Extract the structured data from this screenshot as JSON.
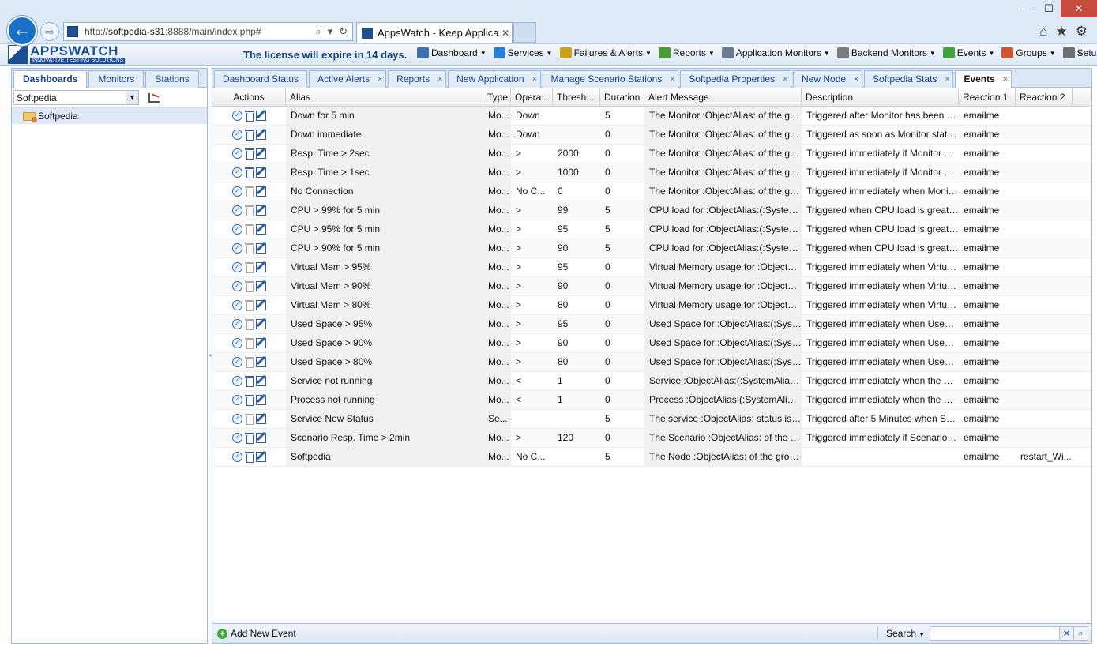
{
  "browser": {
    "url_prefix": "http://",
    "url_domain": "softpedia-s31",
    "url_rest": ":8888/main/index.php#",
    "tab_title": "AppsWatch - Keep Applicat...",
    "tab_close": "✕",
    "back_glyph": "←",
    "forward_glyph": "⇨",
    "search_glyph": "⌕",
    "dropdown_glyph": "▾",
    "refresh_glyph": "↻",
    "home_glyph": "⌂",
    "favorite_glyph": "★",
    "settings_glyph": "⚙",
    "minimize_glyph": "—",
    "maximize_glyph": "☐",
    "close_glyph": "✕"
  },
  "app": {
    "logo_name": "APPSWATCH",
    "logo_tagline": "INNOVATIVE TESTING SOLUTIONS",
    "license_notice": "The license will expire in 14 days.",
    "menu": [
      {
        "label": "Dashboard",
        "icon": "dashboard-icon",
        "color": "#3a6fb0"
      },
      {
        "label": "Services",
        "icon": "services-icon",
        "color": "#2c7fd4"
      },
      {
        "label": "Failures & Alerts",
        "icon": "warning-icon",
        "color": "#c9a21a"
      },
      {
        "label": "Reports",
        "icon": "reports-icon",
        "color": "#4a9a36"
      },
      {
        "label": "Application Monitors",
        "icon": "app-monitor-icon",
        "color": "#6c7a8f"
      },
      {
        "label": "Backend Monitors",
        "icon": "backend-monitor-icon",
        "color": "#7b7b7b"
      },
      {
        "label": "Events",
        "icon": "events-icon",
        "color": "#3ea53b"
      },
      {
        "label": "Groups",
        "icon": "groups-icon",
        "color": "#d2532f"
      },
      {
        "label": "Setup",
        "icon": "setup-icon",
        "color": "#6f6f6f"
      }
    ],
    "menu_more": "»"
  },
  "left_panel": {
    "tabs": [
      "Dashboards",
      "Monitors",
      "Stations"
    ],
    "active_tab": 0,
    "selector_value": "Softpedia",
    "tree_items": [
      "Softpedia"
    ]
  },
  "main_panel": {
    "tabs": [
      {
        "label": "Dashboard Status",
        "closable": false
      },
      {
        "label": "Active Alerts",
        "closable": true
      },
      {
        "label": "Reports",
        "closable": true
      },
      {
        "label": "New Application",
        "closable": true
      },
      {
        "label": "Manage Scenario Stations",
        "closable": true
      },
      {
        "label": "Softpedia Properties",
        "closable": true
      },
      {
        "label": "New Node",
        "closable": true
      },
      {
        "label": "Softpedia Stats",
        "closable": true
      },
      {
        "label": "Events",
        "closable": true
      }
    ],
    "active_tab": 8,
    "close_glyph": "✕",
    "columns": [
      "Actions",
      "Alias",
      "Type",
      "Opera...",
      "Thresh...",
      "Duration",
      "Alert Message",
      "Description",
      "Reaction 1",
      "Reaction 2"
    ],
    "rows": [
      {
        "alias": "Down for 5 min",
        "type": "Mo...",
        "op": "Down",
        "threshold": "",
        "duration": "5",
        "alert": "The Monitor :ObjectAlias: of the gro...",
        "desc": "Triggered after Monitor has been do...",
        "r1": "emailme",
        "r2": "",
        "del_enabled": true
      },
      {
        "alias": "Down immediate",
        "type": "Mo...",
        "op": "Down",
        "threshold": "",
        "duration": "0",
        "alert": "The Monitor :ObjectAlias: of the gro...",
        "desc": "Triggered as soon as Monitor state i...",
        "r1": "emailme",
        "r2": "",
        "del_enabled": true
      },
      {
        "alias": "Resp. Time > 2sec",
        "type": "Mo...",
        "op": ">",
        "threshold": "2000",
        "duration": "0",
        "alert": "The Monitor :ObjectAlias: of the gro...",
        "desc": "Triggered immediately if Monitor Re...",
        "r1": "emailme",
        "r2": "",
        "del_enabled": true
      },
      {
        "alias": "Resp. Time > 1sec",
        "type": "Mo...",
        "op": ">",
        "threshold": "1000",
        "duration": "0",
        "alert": "The Monitor :ObjectAlias: of the gro...",
        "desc": "Triggered immediately if Monitor Re...",
        "r1": "emailme",
        "r2": "",
        "del_enabled": true
      },
      {
        "alias": "No Connection",
        "type": "Mo...",
        "op": "No C...",
        "threshold": "0",
        "duration": "0",
        "alert": "The Monitor :ObjectAlias: of the gro...",
        "desc": "Triggered immediately when Monitor...",
        "r1": "emailme",
        "r2": "",
        "del_enabled": false
      },
      {
        "alias": "CPU > 99% for 5 min",
        "type": "Mo...",
        "op": ">",
        "threshold": "99",
        "duration": "5",
        "alert": "CPU load for :ObjectAlias:(:System...",
        "desc": "Triggered when CPU load is greater...",
        "r1": "emailme",
        "r2": "",
        "del_enabled": false
      },
      {
        "alias": "CPU > 95% for 5 min",
        "type": "Mo...",
        "op": ">",
        "threshold": "95",
        "duration": "5",
        "alert": "CPU load for :ObjectAlias:(:System...",
        "desc": "Triggered when CPU load is greater...",
        "r1": "emailme",
        "r2": "",
        "del_enabled": false
      },
      {
        "alias": "CPU > 90% for 5 min",
        "type": "Mo...",
        "op": ">",
        "threshold": "90",
        "duration": "5",
        "alert": "CPU load for :ObjectAlias:(:System...",
        "desc": "Triggered when CPU load is greater...",
        "r1": "emailme",
        "r2": "",
        "del_enabled": false
      },
      {
        "alias": "Virtual Mem > 95%",
        "type": "Mo...",
        "op": ">",
        "threshold": "95",
        "duration": "0",
        "alert": "Virtual Memory usage for :ObjectAli...",
        "desc": "Triggered immediately when Virtual...",
        "r1": "emailme",
        "r2": "",
        "del_enabled": false
      },
      {
        "alias": "Virtual Mem > 90%",
        "type": "Mo...",
        "op": ">",
        "threshold": "90",
        "duration": "0",
        "alert": "Virtual Memory usage for :ObjectAli...",
        "desc": "Triggered immediately when Virtual...",
        "r1": "emailme",
        "r2": "",
        "del_enabled": false
      },
      {
        "alias": "Virtual Mem > 80%",
        "type": "Mo...",
        "op": ">",
        "threshold": "80",
        "duration": "0",
        "alert": "Virtual Memory usage for :ObjectAli...",
        "desc": "Triggered immediately when Virtual...",
        "r1": "emailme",
        "r2": "",
        "del_enabled": false
      },
      {
        "alias": "Used Space > 95%",
        "type": "Mo...",
        "op": ">",
        "threshold": "95",
        "duration": "0",
        "alert": "Used Space for :ObjectAlias:(:Syste...",
        "desc": "Triggered immediately when Used S...",
        "r1": "emailme",
        "r2": "",
        "del_enabled": false
      },
      {
        "alias": "Used Space > 90%",
        "type": "Mo...",
        "op": ">",
        "threshold": "90",
        "duration": "0",
        "alert": "Used Space for :ObjectAlias:(:Syste...",
        "desc": "Triggered immediately when Used S...",
        "r1": "emailme",
        "r2": "",
        "del_enabled": false
      },
      {
        "alias": "Used Space > 80%",
        "type": "Mo...",
        "op": ">",
        "threshold": "80",
        "duration": "0",
        "alert": "Used Space for :ObjectAlias:(:Syste...",
        "desc": "Triggered immediately when Used S...",
        "r1": "emailme",
        "r2": "",
        "del_enabled": false
      },
      {
        "alias": "Service not running",
        "type": "Mo...",
        "op": "<",
        "threshold": "1",
        "duration": "0",
        "alert": "Service :ObjectAlias:(:SystemAlias:)...",
        "desc": "Triggered immediately when the Ser...",
        "r1": "emailme",
        "r2": "",
        "del_enabled": true
      },
      {
        "alias": "Process not running",
        "type": "Mo...",
        "op": "<",
        "threshold": "1",
        "duration": "0",
        "alert": "Process :ObjectAlias:(:SystemAlias:...",
        "desc": "Triggered immediately when the Pro...",
        "r1": "emailme",
        "r2": "",
        "del_enabled": true
      },
      {
        "alias": "Service New Status",
        "type": "Se...",
        "op": "",
        "threshold": "",
        "duration": "5",
        "alert": "The service :ObjectAlias: status is :...",
        "desc": "Triggered after 5 Minutes when Serv...",
        "r1": "emailme",
        "r2": "",
        "del_enabled": false
      },
      {
        "alias": "Scenario Resp. Time > 2min",
        "type": "Mo...",
        "op": ">",
        "threshold": "120",
        "duration": "0",
        "alert": "The Scenario :ObjectAlias: of the gr...",
        "desc": "Triggered immediately if Scenario R...",
        "r1": "emailme",
        "r2": "",
        "del_enabled": true
      },
      {
        "alias": "Softpedia",
        "type": "Mo...",
        "op": "No C...",
        "threshold": "",
        "duration": "5",
        "alert": "The Node :ObjectAlias: of the group...",
        "desc": "",
        "r1": "emailme",
        "r2": "restart_Wi...",
        "del_enabled": true
      }
    ],
    "add_event_label": "Add New Event",
    "search_label": "Search",
    "search_value": "",
    "search_clear_glyph": "✕",
    "search_go_glyph": "⌕"
  }
}
